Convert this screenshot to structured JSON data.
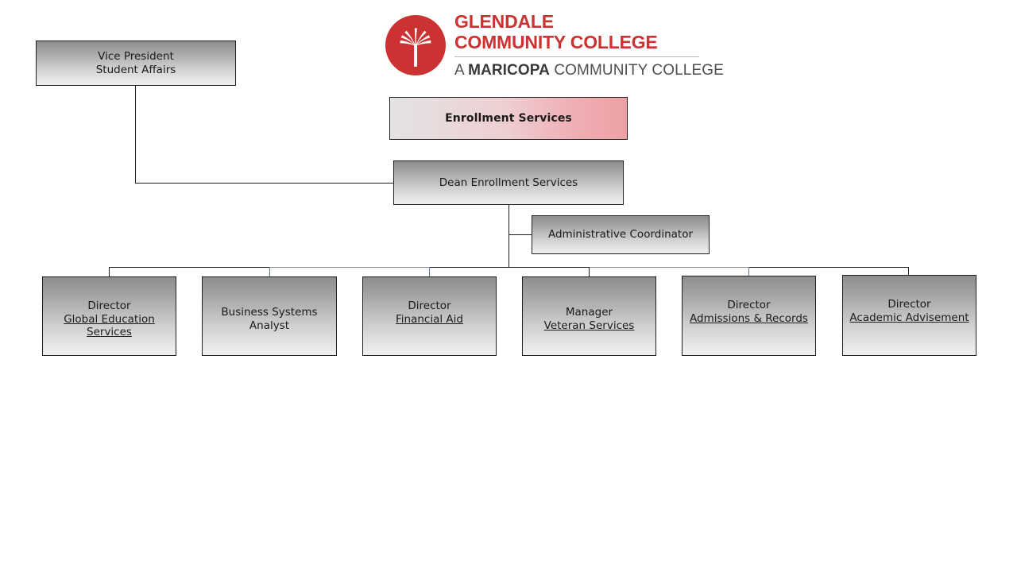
{
  "logo": {
    "icon": "palm-tree-circle-logo",
    "line1": "GLENDALE",
    "line2": "COMMUNITY COLLEGE",
    "tagline_prefix": "A ",
    "tagline_bold": "MARICOPA",
    "tagline_suffix": " COMMUNITY COLLEGE",
    "brand_red": "#cd3232"
  },
  "chart": {
    "title": "Enrollment Services",
    "nodes": {
      "vice_president": {
        "line1": "Vice President",
        "line2": "Student Affairs"
      },
      "dean": {
        "line1": "Dean  Enrollment  Services"
      },
      "admin_coordinator": {
        "line1": "Administrative  Coordinator"
      }
    },
    "reports": [
      {
        "id": "global-education-services",
        "line1": "Director",
        "line2": "Global Education",
        "line3": "Services",
        "underline": true
      },
      {
        "id": "business-systems-analyst",
        "line1": "Business  Systems",
        "line2": "Analyst",
        "line3": "",
        "underline": false
      },
      {
        "id": "financial-aid",
        "line1": "Director",
        "line2": "Financial  Aid",
        "line3": "",
        "underline": true
      },
      {
        "id": "veteran-services",
        "line1": "Manager",
        "line2": "Veteran Services",
        "line3": "",
        "underline": true
      },
      {
        "id": "admissions-and-records",
        "line1": "Director",
        "line2": "Admissions  &  Records",
        "line3": "",
        "underline": true
      },
      {
        "id": "academic-advisement",
        "line1": "Director",
        "line2": "Academic  Advisement",
        "line3": "",
        "underline": true
      }
    ]
  }
}
